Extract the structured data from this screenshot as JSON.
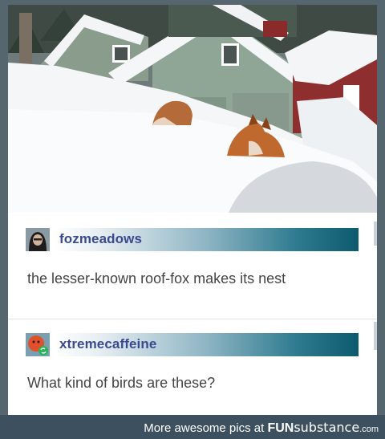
{
  "posts": [
    {
      "username": "fozmeadows",
      "text": "the lesser-known roof-fox makes its nest"
    },
    {
      "username": "xtremecaffeine",
      "text": "What kind of birds are these?"
    }
  ],
  "footer": {
    "text": "More awesome pics at",
    "brand_a": "FUN",
    "brand_b": "substance",
    "brand_c": ".com"
  },
  "colors": {
    "username": "#3b4a8f",
    "bar_end": "#0d5a6e",
    "footer_bg": "#3d5060"
  }
}
